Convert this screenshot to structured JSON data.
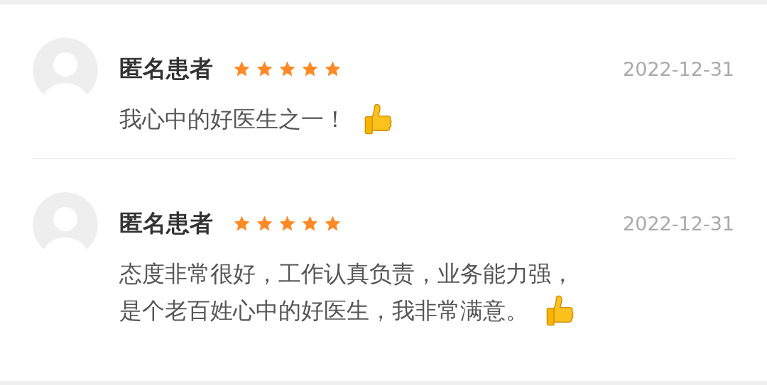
{
  "reviews": [
    {
      "name": "匿名患者",
      "stars": 5,
      "date": "2022-12-31",
      "comment_lines": [
        "我心中的好医生之一！"
      ]
    },
    {
      "name": "匿名患者",
      "stars": 5,
      "date": "2022-12-31",
      "comment_lines": [
        "态度非常很好，工作认真负责，业务能力强，",
        "是个老百姓心中的好医生，我非常满意。"
      ]
    }
  ]
}
